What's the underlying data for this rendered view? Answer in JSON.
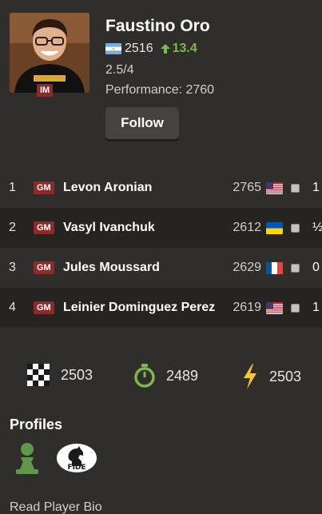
{
  "player": {
    "name": "Faustino Oro",
    "title": "IM",
    "rating": "2516",
    "rating_change": "13.4",
    "score": "2.5/4",
    "performance": "Performance: 2760",
    "follow_label": "Follow"
  },
  "opponents": [
    {
      "rank": "1",
      "title": "GM",
      "name": "Levon Aronian",
      "rating": "2765",
      "flag": "us",
      "result": "1"
    },
    {
      "rank": "2",
      "title": "GM",
      "name": "Vasyl Ivanchuk",
      "rating": "2612",
      "flag": "ua",
      "result": "½"
    },
    {
      "rank": "3",
      "title": "GM",
      "name": "Jules Moussard",
      "rating": "2629",
      "flag": "fr",
      "result": "0"
    },
    {
      "rank": "4",
      "title": "GM",
      "name": "Leinier Dominguez Perez",
      "rating": "2619",
      "flag": "us",
      "result": "1"
    }
  ],
  "stats": {
    "classical": "2503",
    "rapid": "2489",
    "blitz": "2503"
  },
  "profiles": {
    "title": "Profiles",
    "icons": [
      "chesscom-pawn-icon",
      "fide-icon"
    ],
    "fide_label": "FIDE"
  },
  "bio_link": "Read Player Bio",
  "colors": {
    "background": "#302e2b",
    "row_alt": "#262421",
    "title_badge": "#8f2a2a",
    "gain": "#81b64c",
    "rapid": "#81b64c",
    "blitz": "#f7c631"
  }
}
